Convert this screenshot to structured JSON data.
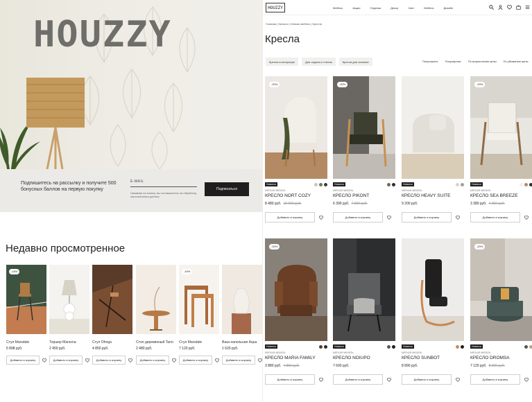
{
  "left": {
    "hero_logo": "HOUZZY",
    "newsletter": {
      "text": "Подпишитесь на рассылку и получите 500 бонусных баллов на первую покупку",
      "email_label": "E-MAIL",
      "fine_print": "Нажимая на кнопку, вы соглашаетесь на обработку персональных данных",
      "button": "Подписаться"
    },
    "recent_title": "Недавно просмотренное",
    "recent": [
      {
        "discount": "-15%",
        "name": "Стул Marsdale",
        "price": "5 898 руб.",
        "cart": "Добавить в корзину"
      },
      {
        "discount": "",
        "name": "Торшер Marsona",
        "price": "2 450 руб.",
        "cart": "Добавить в корзину"
      },
      {
        "discount": "",
        "name": "Стул Ofrega",
        "price": "4 850 руб.",
        "cart": "Добавить в корзину"
      },
      {
        "discount": "",
        "name": "Стол деревянный Tarro",
        "price": "2 480 руб.",
        "cart": "Добавить в корзину"
      },
      {
        "discount": "-15%",
        "name": "Стул Marsdale",
        "price": "7 120 руб.",
        "cart": "Добавить в корзину"
      },
      {
        "discount": "",
        "name": "Ваза напольная Aqua",
        "price": "1 620 руб.",
        "cart": "Добавить в корзину"
      }
    ]
  },
  "right": {
    "brand": "HOUZZY",
    "nav": [
      "Мебель",
      "Акции",
      "Отделка",
      "Декор",
      "Свет",
      "Мебель",
      "Дизайн"
    ],
    "breadcrumbs": "Главная  |  Каталог  |  Мягкая мебель  |  Кресла",
    "title": "Кресла",
    "filters": [
      "Кресла в интерьере",
      "Для отдыха и чтения",
      "Кресла для спальни"
    ],
    "sorts": [
      "Популярное",
      "Популярные",
      "По возрастанию цены",
      "По убыванию цены"
    ],
    "products": [
      {
        "discount": "-20%",
        "badge": "Новинка",
        "sub": "МЯГКАЯ МЕБЕЛЬ",
        "name": "КРЕСЛО NORT COZY",
        "price": "8 480 руб.",
        "old": "10 600 руб.",
        "cart": "Добавить в корзину",
        "swatches": [
          "#c9c5b7",
          "#6f7660",
          "#3b3b35"
        ]
      },
      {
        "discount": "-20%",
        "badge": "Новинка",
        "sub": "МЯГКАЯ МЕБЕЛЬ",
        "name": "КРЕСЛО PIKONT",
        "price": "6 390 руб.",
        "old": "7 900 руб.",
        "cart": "Добавить в корзину",
        "swatches": [
          "#6e6a55",
          "#2f2f2a"
        ]
      },
      {
        "discount": "",
        "badge": "Новинка",
        "sub": "МЯГКАЯ МЕБЕЛЬ",
        "name": "КРЕСЛО HEAVY SUITE",
        "price": "9 200 руб.",
        "old": "",
        "cart": "Добавить в корзину",
        "swatches": [
          "#d8d4cc",
          "#a69f94"
        ]
      },
      {
        "discount": "-20%",
        "badge": "Новинка",
        "sub": "МЯГКАЯ МЕБЕЛЬ",
        "name": "КРЕСЛО SEA BREEZE",
        "price": "3 380 руб.",
        "old": "4 250 руб.",
        "cart": "Добавить в корзину",
        "swatches": [
          "#f1efe9",
          "#b18c69",
          "#2f2f2a"
        ]
      },
      {
        "discount": "-20%",
        "badge": "Новинка",
        "sub": "МЯГКАЯ МЕБЕЛЬ",
        "name": "КРЕСЛО MARIA FAMILY",
        "price": "3 880 руб.",
        "old": "4 850 руб.",
        "cart": "Добавить в корзину",
        "swatches": [
          "#5b3a26",
          "#2a2a2a"
        ]
      },
      {
        "discount": "",
        "badge": "Новинка",
        "sub": "МЯГКАЯ МЕБЕЛЬ",
        "name": "КРЕСЛО NOIUPO",
        "price": "7 600 руб.",
        "old": "",
        "cart": "Добавить в корзину",
        "swatches": [
          "#58595a",
          "#1f1f1f"
        ]
      },
      {
        "discount": "",
        "badge": "Новинка",
        "sub": "МЯГКАЯ МЕБЕЛЬ",
        "name": "КРЕСЛО SUNBOT",
        "price": "8 890 руб.",
        "old": "",
        "cart": "Добавить в корзину",
        "swatches": [
          "#c48d5e",
          "#1f1f1f"
        ]
      },
      {
        "discount": "-20%",
        "badge": "Новинка",
        "sub": "МЯГКАЯ МЕБЕЛЬ",
        "name": "КРЕСЛО DROMSA",
        "price": "7 120 руб.",
        "old": "8 900 руб.",
        "cart": "Добавить в корзину",
        "swatches": [
          "#4a5855",
          "#b0a58d"
        ]
      }
    ]
  }
}
